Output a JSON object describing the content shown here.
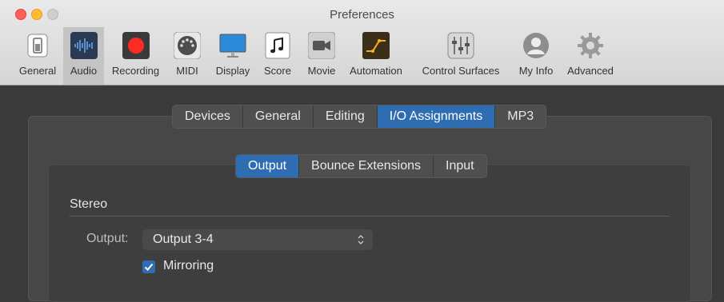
{
  "window": {
    "title": "Preferences"
  },
  "toolbar": {
    "items": [
      {
        "label": "General",
        "icon": "general-switch-icon"
      },
      {
        "label": "Audio",
        "icon": "audio-waveform-icon"
      },
      {
        "label": "Recording",
        "icon": "record-icon"
      },
      {
        "label": "MIDI",
        "icon": "midi-connector-icon"
      },
      {
        "label": "Display",
        "icon": "display-monitor-icon"
      },
      {
        "label": "Score",
        "icon": "score-note-icon"
      },
      {
        "label": "Movie",
        "icon": "movie-camera-icon"
      },
      {
        "label": "Automation",
        "icon": "automation-curve-icon"
      },
      {
        "label": "Control Surfaces",
        "icon": "control-surfaces-faders-icon"
      },
      {
        "label": "My Info",
        "icon": "user-silhouette-icon"
      },
      {
        "label": "Advanced",
        "icon": "gear-icon"
      }
    ],
    "selected": "Audio"
  },
  "main_tabs": {
    "items": [
      "Devices",
      "General",
      "Editing",
      "I/O Assignments",
      "MP3"
    ],
    "selected": "I/O Assignments"
  },
  "sub_tabs": {
    "items": [
      "Output",
      "Bounce Extensions",
      "Input"
    ],
    "selected": "Output"
  },
  "stereo": {
    "section_label": "Stereo",
    "output_label": "Output:",
    "output_value": "Output 3-4",
    "mirroring_label": "Mirroring",
    "mirroring_checked": true
  },
  "colors": {
    "accent": "#2f6db3",
    "record_red": "#fb2c23"
  }
}
